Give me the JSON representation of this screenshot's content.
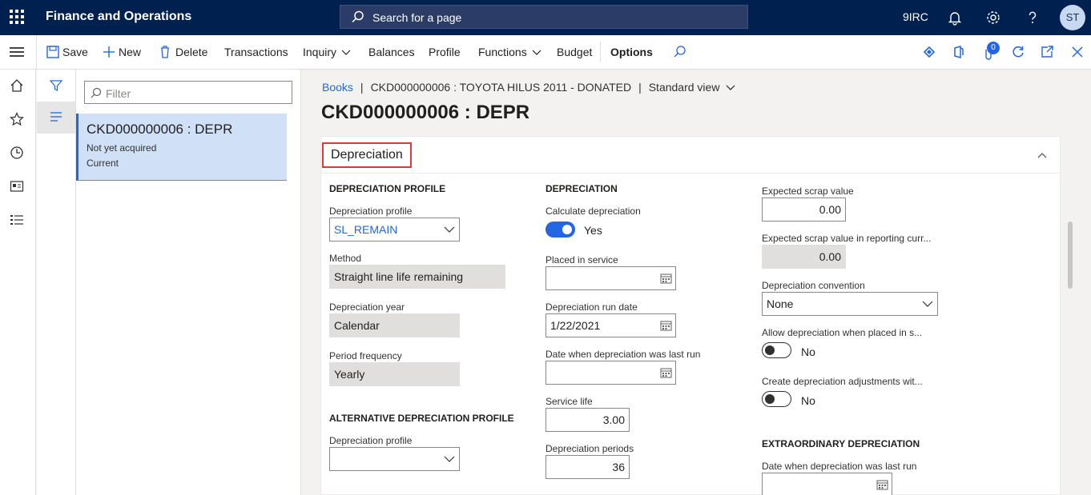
{
  "topbar": {
    "app_title": "Finance and Operations",
    "search_placeholder": "Search for a page",
    "company": "9IRC",
    "avatar_initials": "ST"
  },
  "actions": {
    "save": "Save",
    "new": "New",
    "delete": "Delete",
    "transactions": "Transactions",
    "inquiry": "Inquiry",
    "balances": "Balances",
    "profile": "Profile",
    "functions": "Functions",
    "budget": "Budget",
    "options": "Options",
    "attachments_count": "0"
  },
  "list": {
    "filter_placeholder": "Filter",
    "items": [
      {
        "title": "CKD000000006 : DEPR",
        "status": "Not yet acquired",
        "subtitle": "Current"
      }
    ]
  },
  "breadcrumb": {
    "root": "Books",
    "record": "CKD000000006 : TOYOTA HILUS 2011 - DONATED",
    "view": "Standard view"
  },
  "page_title": "CKD000000006 : DEPR",
  "fasttab": {
    "title": "Depreciation"
  },
  "col1": {
    "group_title": "DEPRECIATION PROFILE",
    "profile_label": "Depreciation profile",
    "profile_value": "SL_REMAIN",
    "method_label": "Method",
    "method_value": "Straight line life remaining",
    "year_label": "Depreciation year",
    "year_value": "Calendar",
    "freq_label": "Period frequency",
    "freq_value": "Yearly",
    "alt_group_title": "ALTERNATIVE DEPRECIATION PROFILE",
    "alt_profile_label": "Depreciation profile",
    "alt_profile_value": ""
  },
  "col2": {
    "group_title": "DEPRECIATION",
    "calc_label": "Calculate depreciation",
    "calc_value": "Yes",
    "placed_label": "Placed in service",
    "placed_value": "",
    "run_date_label": "Depreciation run date",
    "run_date_value": "1/22/2021",
    "last_run_label": "Date when depreciation was last run",
    "last_run_value": "",
    "service_life_label": "Service life",
    "service_life_value": "3.00",
    "periods_label": "Depreciation periods",
    "periods_value": "36"
  },
  "col3": {
    "scrap_label": "Expected scrap value",
    "scrap_value": "0.00",
    "scrap_rep_label": "Expected scrap value in reporting curr...",
    "scrap_rep_value": "0.00",
    "convention_label": "Depreciation convention",
    "convention_value": "None",
    "allow_label": "Allow depreciation when placed in s...",
    "allow_value": "No",
    "adjust_label": "Create depreciation adjustments wit...",
    "adjust_value": "No",
    "extra_group_title": "EXTRAORDINARY DEPRECIATION",
    "extra_last_run_label": "Date when depreciation was last run",
    "extra_last_run_value": ""
  },
  "colors": {
    "topbar": "#002050",
    "accent": "#2266e3",
    "highlight_border": "#e03838",
    "selected_item": "#cfe0f7"
  }
}
